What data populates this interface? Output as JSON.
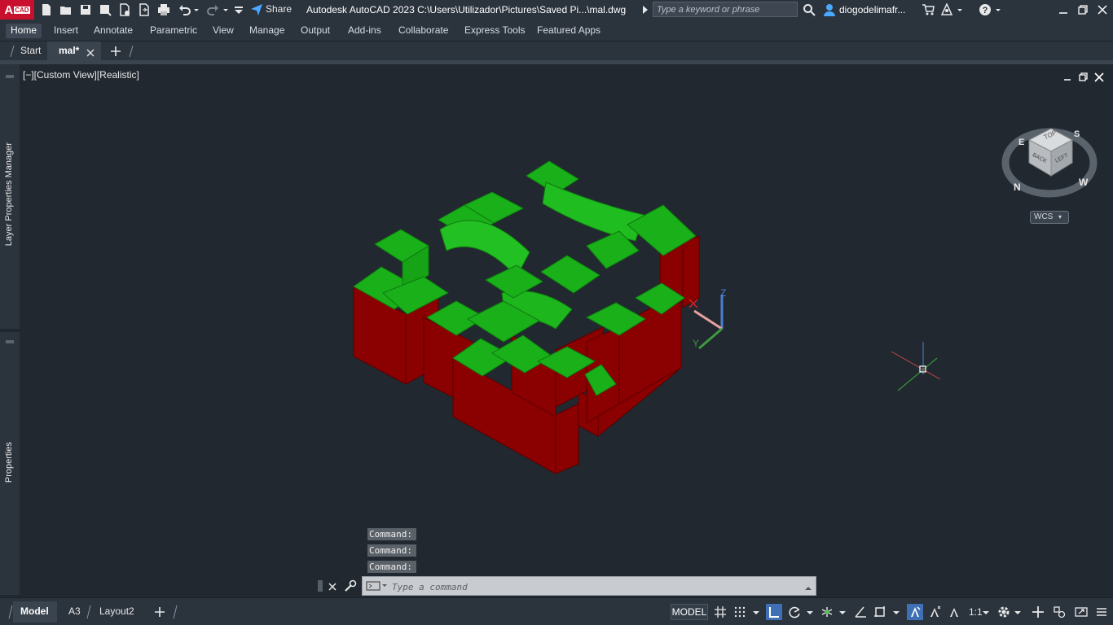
{
  "titlebar": {
    "logo_letter": "A",
    "logo_tag": "CAD",
    "share_label": "Share",
    "title": "Autodesk AutoCAD 2023   C:\\Users\\Utilizador\\Pictures\\Saved Pi...\\mal.dwg",
    "search_placeholder": "Type a keyword or phrase",
    "user_name": "diogodelimafr..."
  },
  "ribbon": {
    "tabs": [
      "Home",
      "Insert",
      "Annotate",
      "Parametric",
      "View",
      "Manage",
      "Output",
      "Add-ins",
      "Collaborate",
      "Express Tools",
      "Featured Apps"
    ],
    "active_tab": "Home"
  },
  "doc_tabs": {
    "start": "Start",
    "current": "mal*"
  },
  "palettes": {
    "layer_properties": "Layer Properties Manager",
    "properties": "Properties"
  },
  "viewport": {
    "label": "[−][Custom View][Realistic]",
    "viewcube": {
      "top": "TOP",
      "back": "BACK",
      "left": "LEFT",
      "compass_n": "N",
      "compass_e": "E",
      "compass_w": "W",
      "compass_s": "S",
      "wcs": "WCS"
    },
    "ucs": {
      "z": "Z",
      "y": "Y"
    },
    "colors": {
      "background": "#212830",
      "top_face": "#19b019",
      "side_face": "#8b0000"
    }
  },
  "command": {
    "history": [
      "Command:",
      "Command:",
      "Command:"
    ],
    "placeholder": "Type a command"
  },
  "status": {
    "layout_tabs": [
      "Model",
      "A3",
      "Layout2"
    ],
    "active_layout": "Model",
    "model_button": "MODEL",
    "scale": "1:1"
  }
}
